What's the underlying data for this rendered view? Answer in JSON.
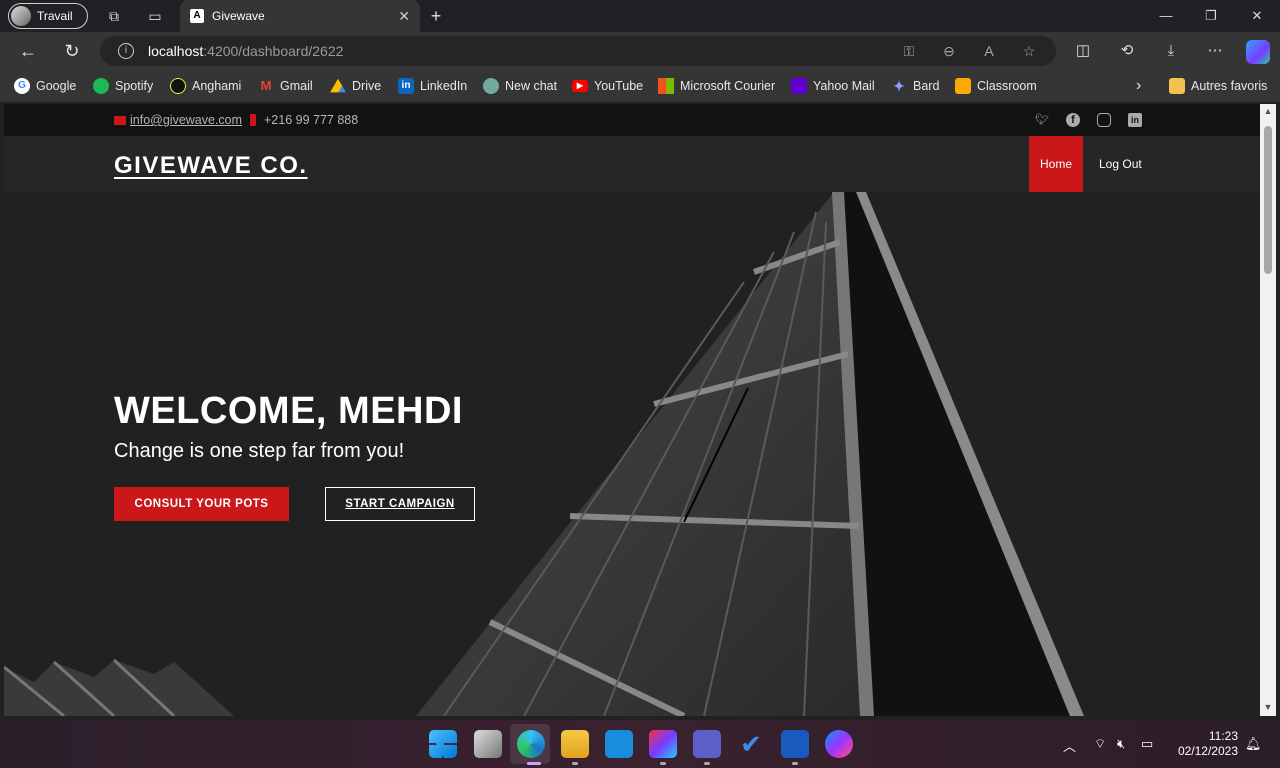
{
  "browser": {
    "profile_label": "Travail",
    "tab_title": "Givewave",
    "tab_favicon": "A",
    "url_host": "localhost",
    "url_path": ":4200/dashboard/2622"
  },
  "bookmarks": [
    {
      "label": "Google",
      "icon": "google-icon",
      "color": "#4285f4"
    },
    {
      "label": "Spotify",
      "icon": "spotify-icon",
      "color": "#1db954"
    },
    {
      "label": "Anghami",
      "icon": "anghami-icon",
      "color": "#0d0d0d"
    },
    {
      "label": "Gmail",
      "icon": "gmail-icon",
      "color": "#ea4335"
    },
    {
      "label": "Drive",
      "icon": "drive-icon",
      "color": "#fbbc04"
    },
    {
      "label": "LinkedIn",
      "icon": "linkedin-icon",
      "color": "#0a66c2"
    },
    {
      "label": "New chat",
      "icon": "chatgpt-icon",
      "color": "#74aa9c"
    },
    {
      "label": "YouTube",
      "icon": "youtube-icon",
      "color": "#ff0000"
    },
    {
      "label": "Microsoft Courier",
      "icon": "microsoft-icon",
      "color": "#f25022"
    },
    {
      "label": "Yahoo Mail",
      "icon": "yahoo-icon",
      "color": "#6001d2"
    },
    {
      "label": "Bard",
      "icon": "bard-icon",
      "color": "#8e7cc3"
    },
    {
      "label": "Classroom",
      "icon": "classroom-icon",
      "color": "#f9ab00"
    }
  ],
  "bookmarks_other": "Autres favoris",
  "site": {
    "contact_email": "info@givewave.com",
    "contact_phone": "+216 99 777 888",
    "brand": "GIVEWAVE CO.",
    "nav_home": "Home",
    "nav_logout": "Log Out",
    "welcome": "WELCOME, MEHDI",
    "tagline": "Change is one step far from you!",
    "btn_pots": "CONSULT YOUR POTS",
    "btn_campaign": "START CAMPAIGN",
    "accent": "#c9171a"
  },
  "taskbar": {
    "time": "11:23",
    "date": "02/12/2023"
  }
}
